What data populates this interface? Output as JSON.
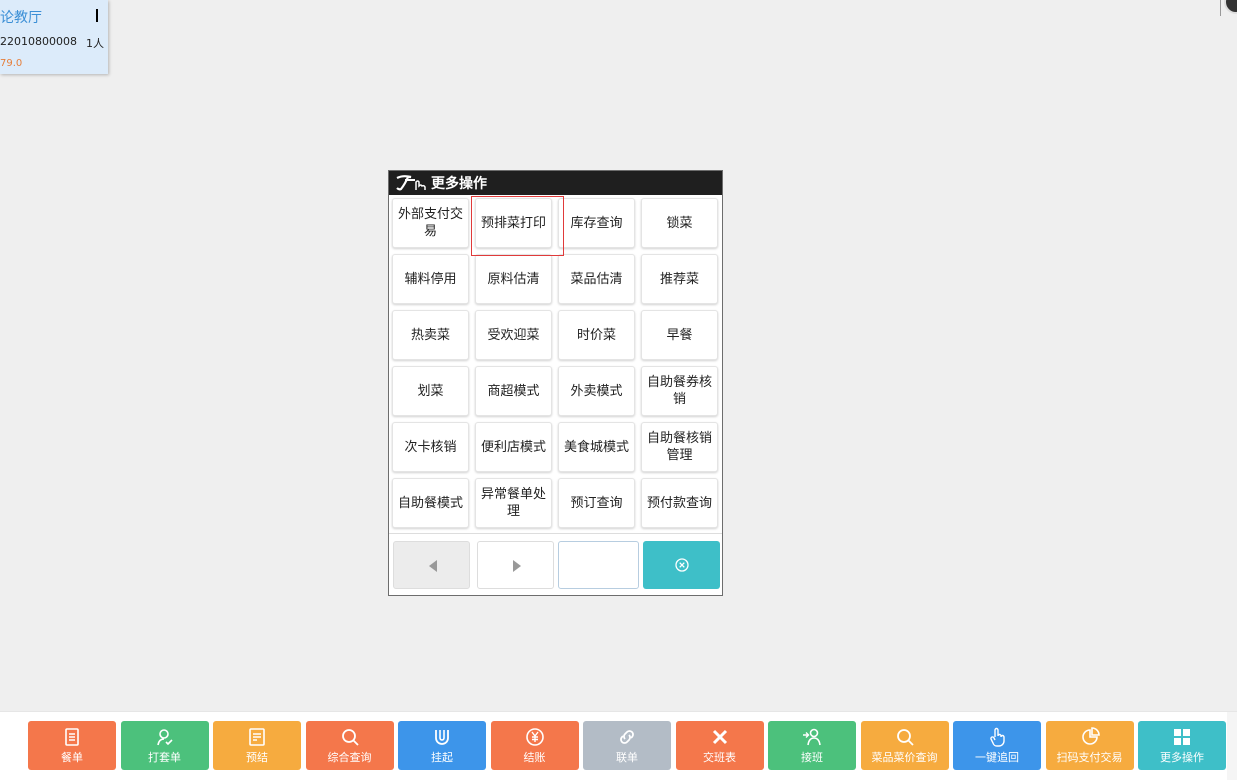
{
  "table_card": {
    "name": "论教厅",
    "order_no": "22010800008",
    "people": "1人",
    "amount": "79.0"
  },
  "dialog": {
    "title": "更多操作",
    "selected_index": 1,
    "buttons": [
      "外部支付交易",
      "预排菜打印",
      "库存查询",
      "锁菜",
      "辅料停用",
      "原料估清",
      "菜品估清",
      "推荐菜",
      "热卖菜",
      "受欢迎菜",
      "时价菜",
      "早餐",
      "划菜",
      "商超模式",
      "外卖模式",
      "自助餐券核销",
      "次卡核销",
      "便利店模式",
      "美食城模式",
      "自助餐核销管理",
      "自助餐模式",
      "异常餐单处理",
      "预订查询",
      "预付款查询"
    ],
    "page_input_value": ""
  },
  "toolbar": [
    {
      "label": "餐单",
      "color": "#f4774b",
      "icon": "list-icon"
    },
    {
      "label": "打套单",
      "color": "#4cc17c",
      "icon": "user-check-icon"
    },
    {
      "label": "预结",
      "color": "#f6ab3f",
      "icon": "note-icon"
    },
    {
      "label": "综合查询",
      "color": "#f4774b",
      "icon": "search-icon"
    },
    {
      "label": "挂起",
      "color": "#3d95ea",
      "icon": "magnet-icon"
    },
    {
      "label": "结账",
      "color": "#f4774b",
      "icon": "yen-icon"
    },
    {
      "label": "联单",
      "color": "#b3bcc6",
      "icon": "link-icon"
    },
    {
      "label": "交班表",
      "color": "#f4774b",
      "icon": "cross-icon"
    },
    {
      "label": "接班",
      "color": "#4cc17c",
      "icon": "user-in-icon"
    },
    {
      "label": "菜品菜价查询",
      "color": "#f6ab3f",
      "icon": "search-icon"
    },
    {
      "label": "一键追回",
      "color": "#3d95ea",
      "icon": "hand-icon"
    },
    {
      "label": "扫码支付交易",
      "color": "#f6ab3f",
      "icon": "pie-icon"
    },
    {
      "label": "更多操作",
      "color": "#3ebfc8",
      "icon": "grid-icon"
    }
  ]
}
